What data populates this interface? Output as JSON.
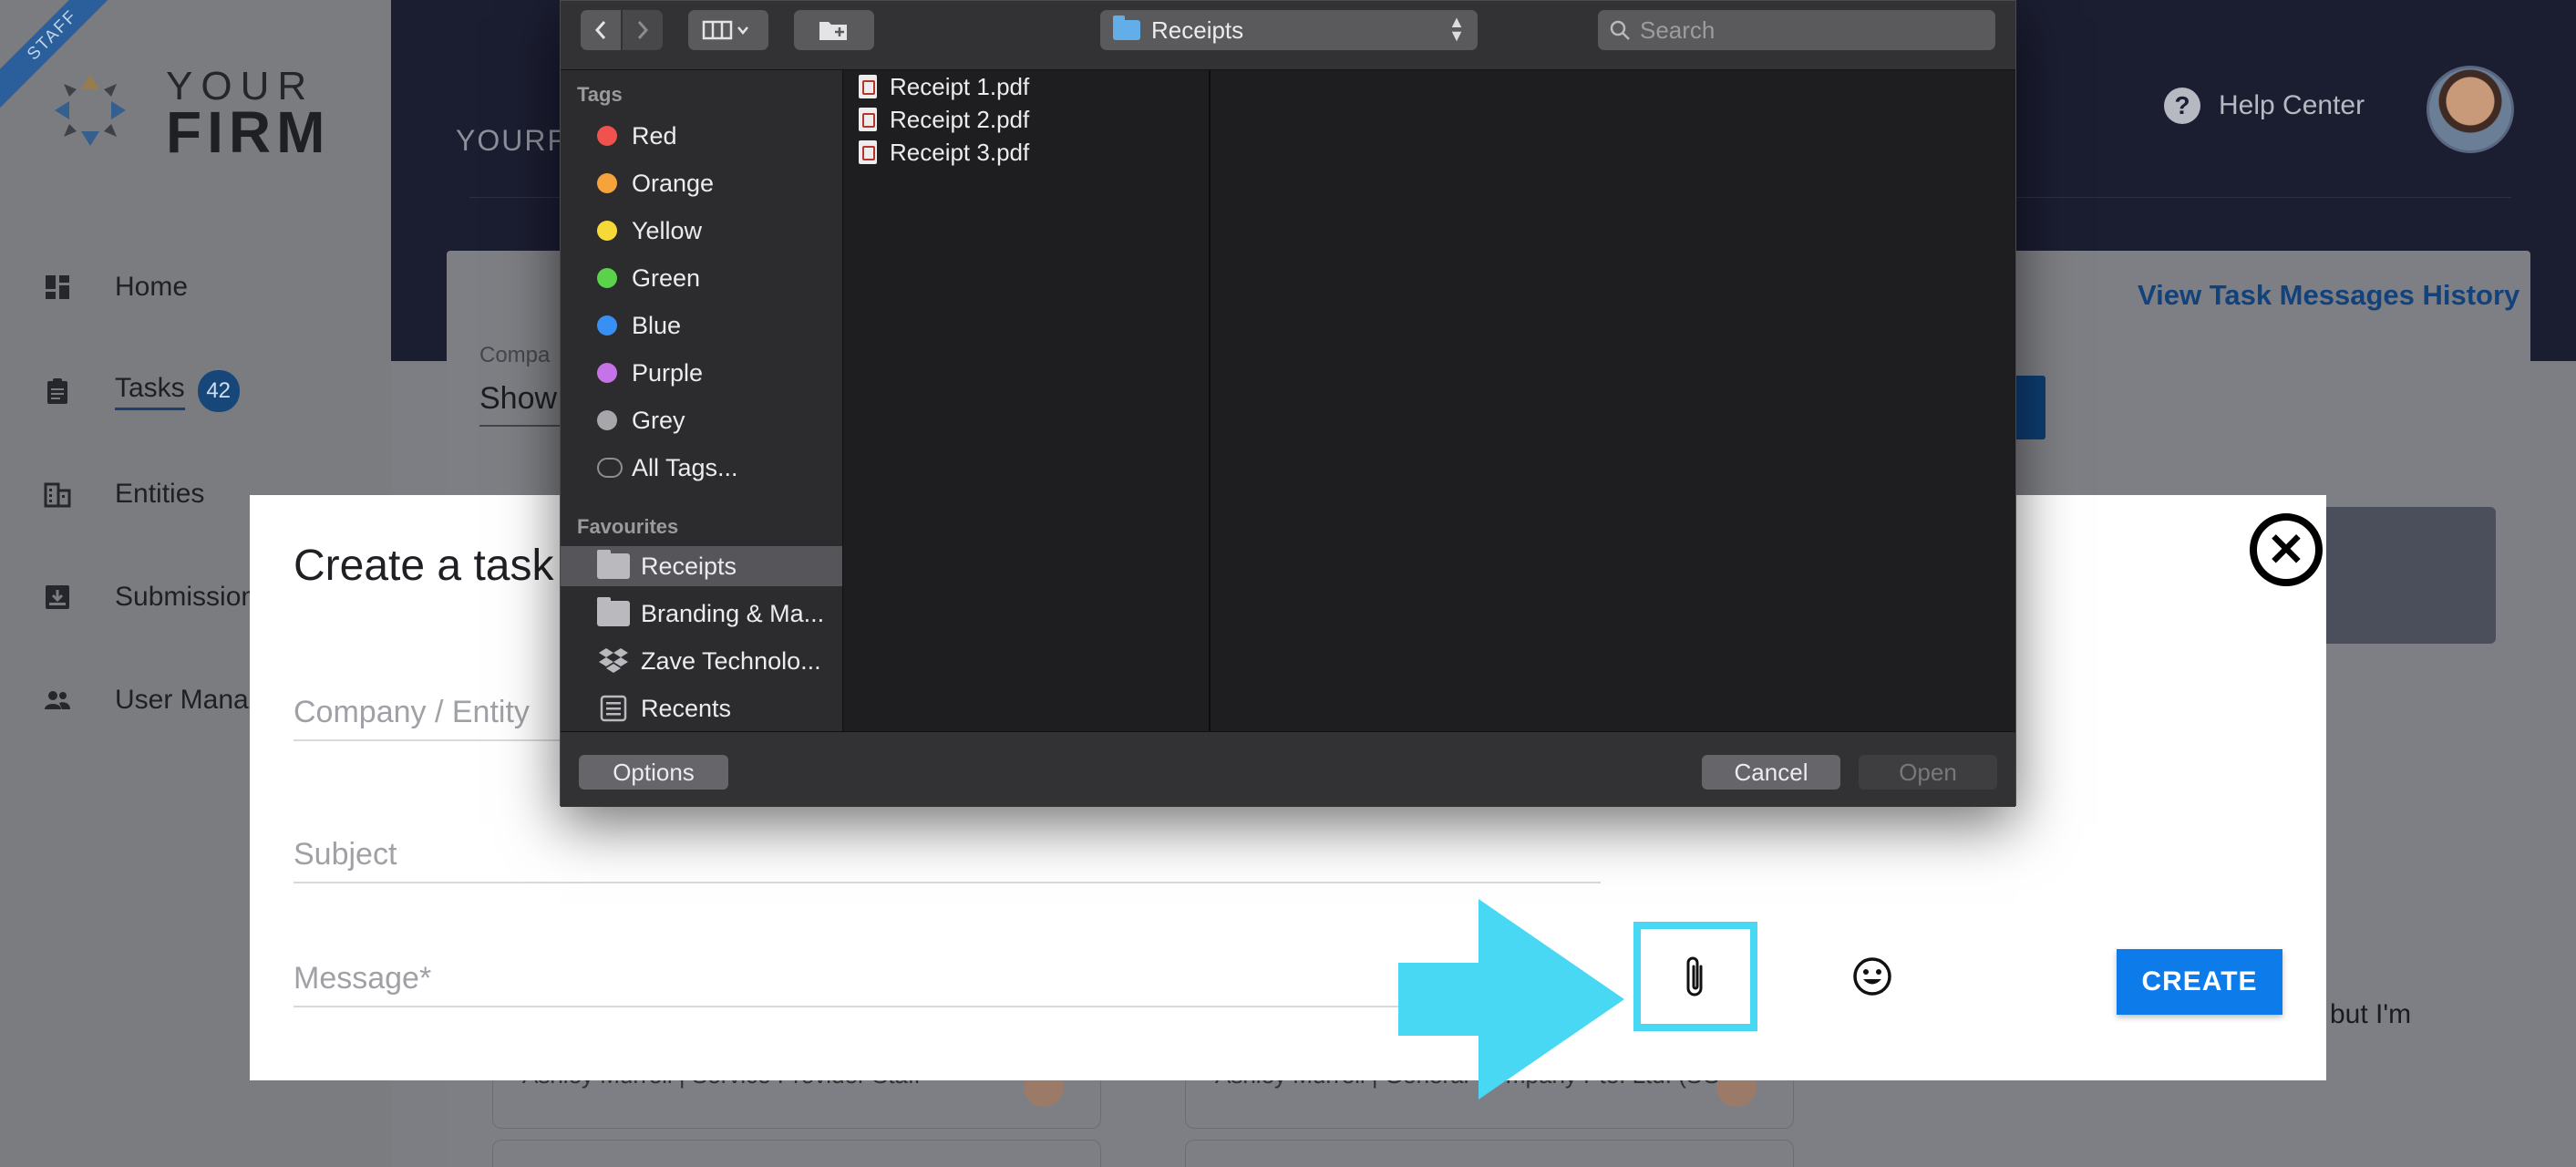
{
  "app": {
    "staff_ribbon": "STAFF",
    "logo_top": "YOUR",
    "logo_bottom": "FIRM",
    "header_title": "YOURF",
    "help_center": "Help Center"
  },
  "sidebar": {
    "items": [
      {
        "label": "Home",
        "icon": "dashboard-icon"
      },
      {
        "label": "Tasks",
        "icon": "clipboard-icon",
        "badge": "42"
      },
      {
        "label": "Entities",
        "icon": "building-icon"
      },
      {
        "label": "Submission",
        "icon": "inbox-download-icon"
      },
      {
        "label": "User Manag",
        "icon": "people-icon"
      }
    ]
  },
  "background": {
    "view_history": "View Task Messages History",
    "filter_label": "Compa",
    "filter_value": "Show",
    "right_text": "but I'm",
    "card1_text": "Ashley Murrell | Service Provider Staff",
    "card2_text": "Ashley Murrell | General Company Pte. Ltd. (SG)"
  },
  "modal": {
    "title": "Create a task",
    "company_placeholder": "Company / Entity",
    "subject_placeholder": "Subject",
    "message_placeholder": "Message*",
    "create_label": "CREATE"
  },
  "file_dialog": {
    "current_folder": "Receipts",
    "search_placeholder": "Search",
    "tags_header": "Tags",
    "tags": [
      {
        "label": "Red",
        "color": "#f0524e"
      },
      {
        "label": "Orange",
        "color": "#f5a33a"
      },
      {
        "label": "Yellow",
        "color": "#f6d936"
      },
      {
        "label": "Green",
        "color": "#5ad24a"
      },
      {
        "label": "Blue",
        "color": "#3a8ff2"
      },
      {
        "label": "Purple",
        "color": "#c573e6"
      },
      {
        "label": "Grey",
        "color": "#a7a7ab"
      }
    ],
    "all_tags": "All Tags...",
    "favourites_header": "Favourites",
    "favourites": [
      {
        "label": "Receipts",
        "icon": "folder-icon",
        "selected": true
      },
      {
        "label": "Branding & Ma...",
        "icon": "folder-icon",
        "selected": false
      },
      {
        "label": "Zave Technolo...",
        "icon": "dropbox-icon",
        "selected": false
      },
      {
        "label": "Recents",
        "icon": "recents-icon",
        "selected": false
      }
    ],
    "files": [
      "Receipt 1.pdf",
      "Receipt 2.pdf",
      "Receipt 3.pdf"
    ],
    "options_label": "Options",
    "cancel_label": "Cancel",
    "open_label": "Open"
  },
  "colors": {
    "highlight_cyan": "#48d8f4",
    "create_blue": "#0d7bea",
    "topbar_navy": "#1b1d31"
  }
}
